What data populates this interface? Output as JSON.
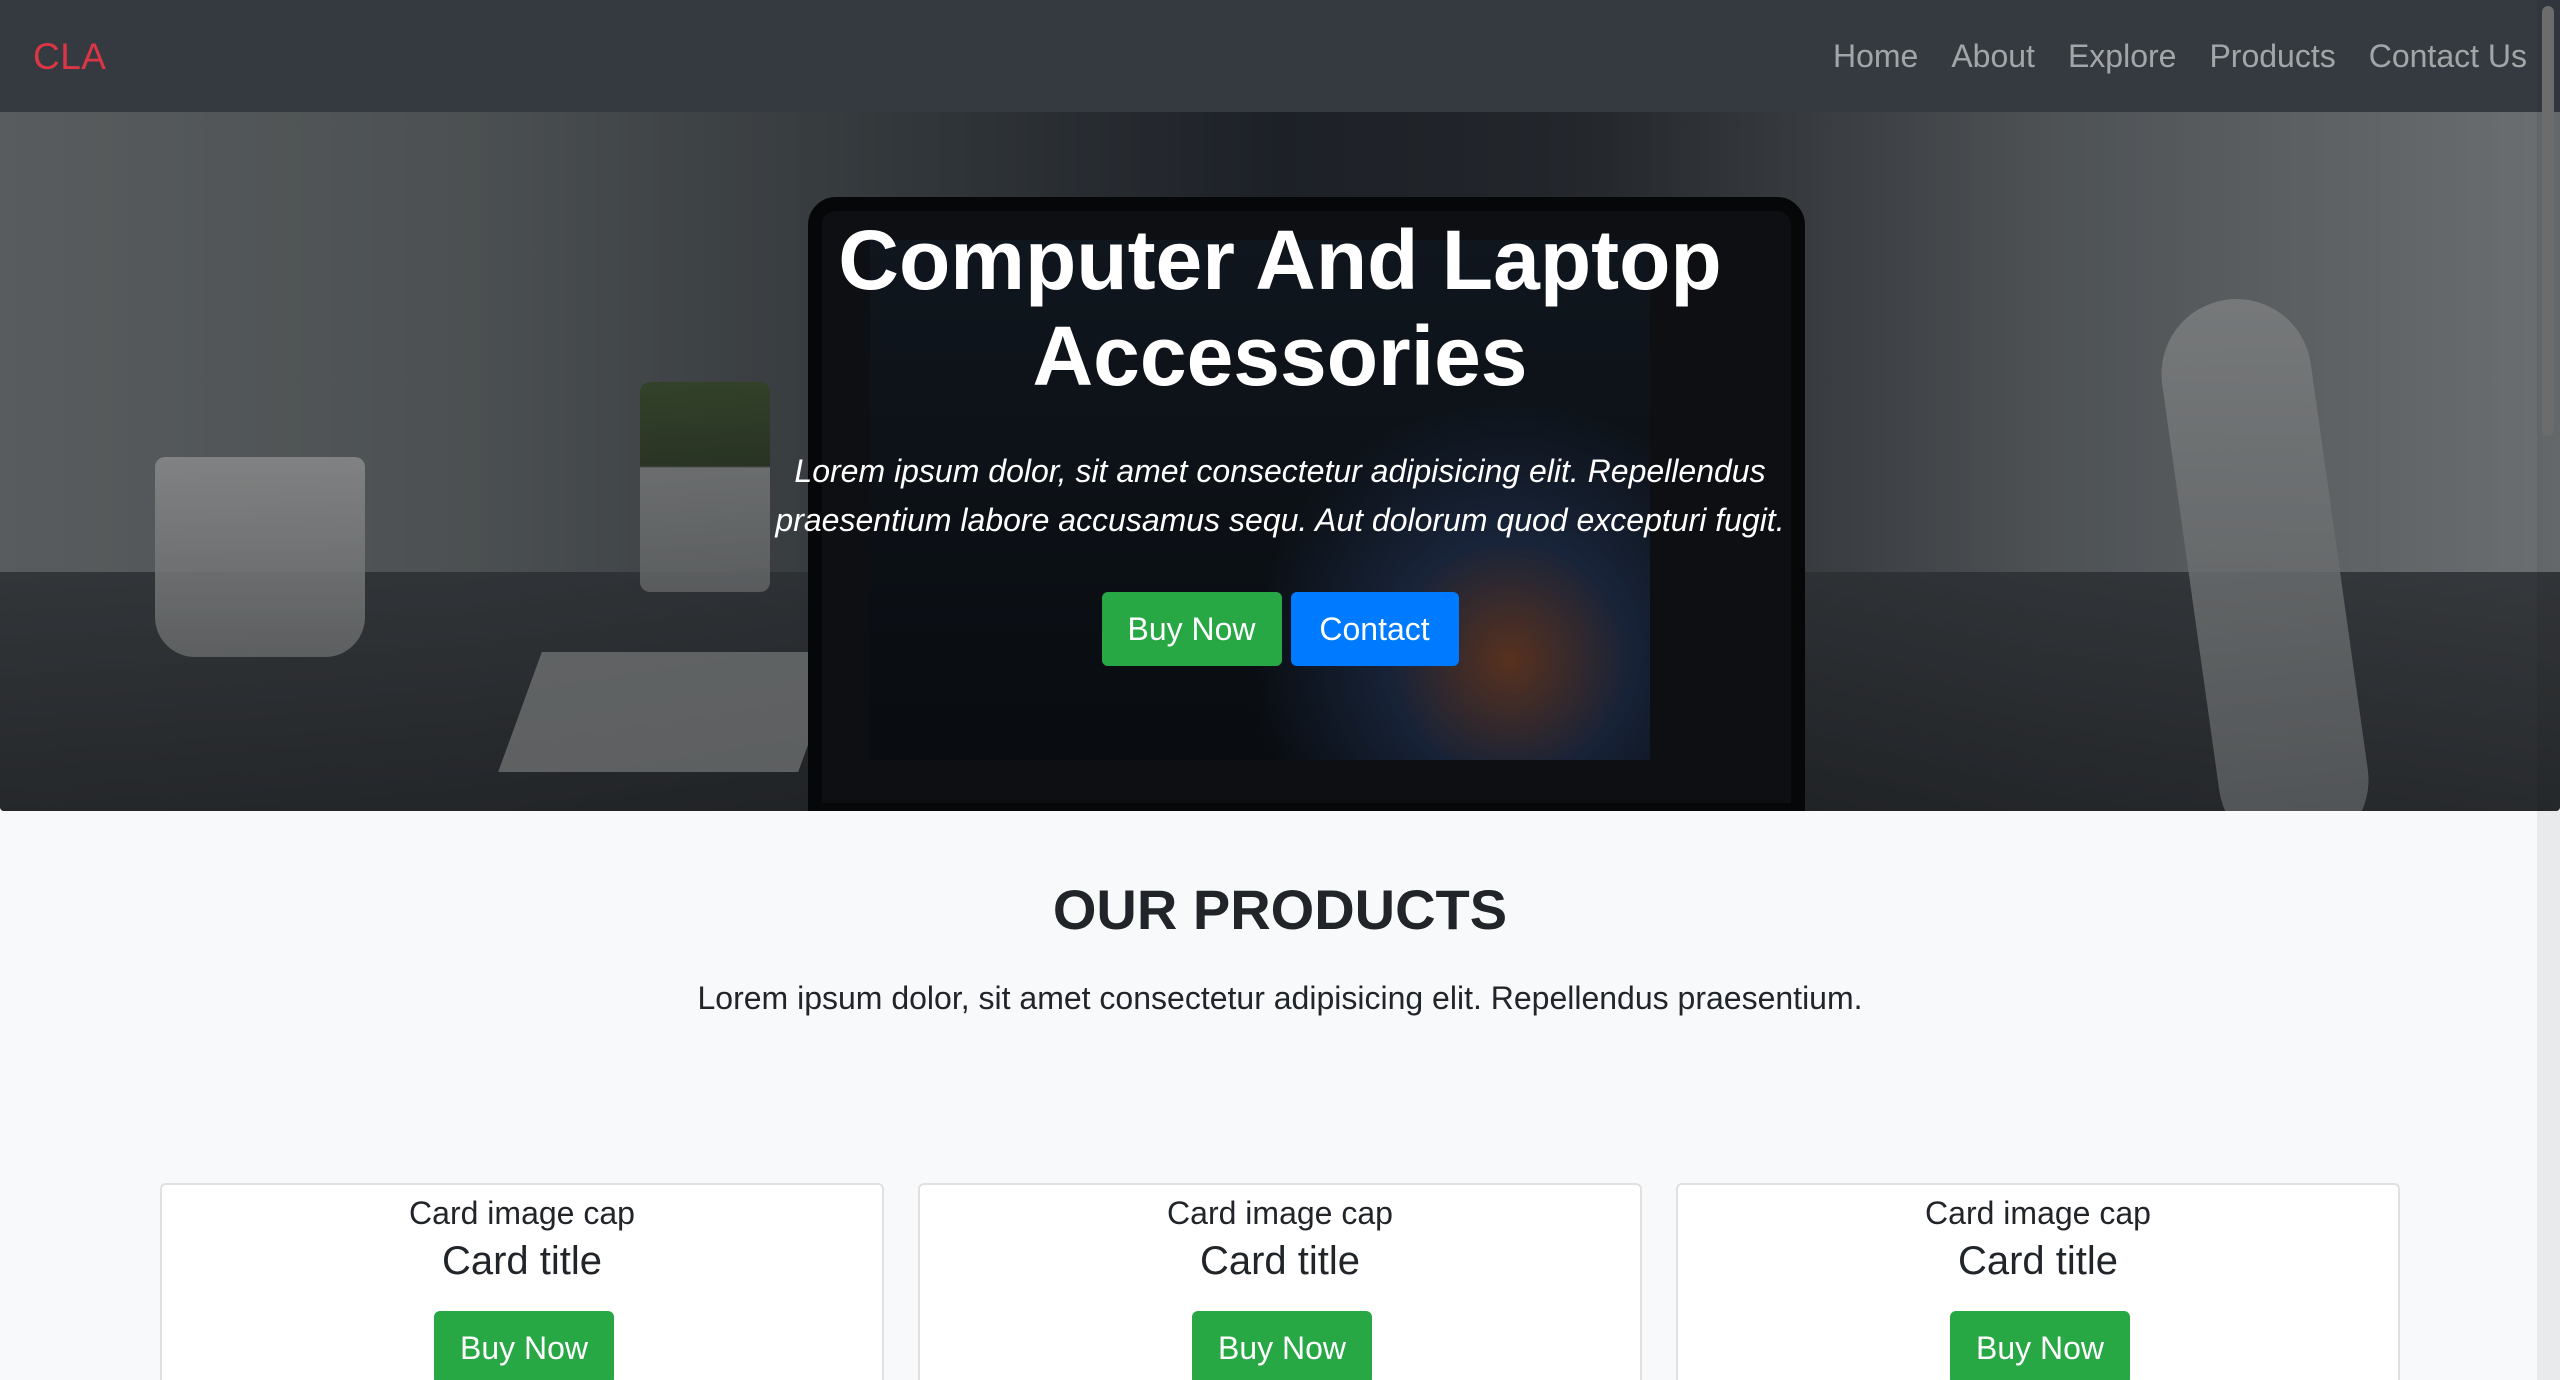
{
  "navbar": {
    "brand": "CLA",
    "links": [
      "Home",
      "About",
      "Explore",
      "Products",
      "Contact Us"
    ]
  },
  "hero": {
    "title": "Computer And Laptop Accessories",
    "text": "Lorem ipsum dolor, sit amet consectetur adipisicing elit. Repellendus praesentium labore accusamus sequ. Aut dolorum quod excepturi fugit.",
    "buy_label": "Buy Now",
    "contact_label": "Contact"
  },
  "products": {
    "title": "OUR PRODUCTS",
    "text": "Lorem ipsum dolor, sit amet consectetur adipisicing elit. Repellendus praesentium.",
    "cards": [
      {
        "image_cap": "Card image cap",
        "title": "Card title",
        "button": "Buy Now"
      },
      {
        "image_cap": "Card image cap",
        "title": "Card title",
        "button": "Buy Now"
      },
      {
        "image_cap": "Card image cap",
        "title": "Card title",
        "button": "Buy Now"
      }
    ]
  },
  "colors": {
    "navbar_bg": "#343a40",
    "brand": "#dc3545",
    "success": "#28a745",
    "primary": "#007bff",
    "page_bg": "#f8f9fa"
  }
}
